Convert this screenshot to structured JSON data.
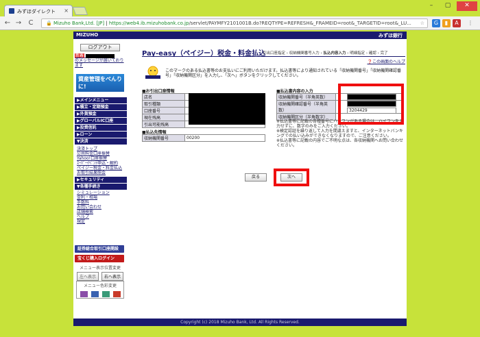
{
  "browser": {
    "tab_title": "みずほダイレクト",
    "tab_close": "×",
    "win_min": "–",
    "win_max": "▢",
    "win_close": "✕",
    "back": "←",
    "forward": "→",
    "reload": "C",
    "url_secure_label": "Mizuho Bank,Ltd. [JP]",
    "url_host": "https://web4.ib.mizuhobank.co.jp",
    "url_path": "/servlet/PAYMFY2101001B.do?REQTYPE=REFRESH&_FRAMEID=root&_TARGETID=root&_LU..."
  },
  "header": {
    "logo": "MIZUHO",
    "right_logo": "みずほ銀行"
  },
  "sidebar": {
    "logout": "ログアウト",
    "notice_new": "新着",
    "notice_text": "のメッセージが届いております",
    "banner_title": "資産管理をべんりに!",
    "banner_sub": "マイページはこちら",
    "menu_main": "▶メインメニュー",
    "menu_deposit": "▶積立・定期預金",
    "menu_forex": "▶外貨預金",
    "menu_global": "▶グローバルIC口座",
    "menu_invest": "▶投資信託",
    "menu_loan": "▶ローン",
    "menu_settle": "▼決済",
    "settle_items": [
      "決済トップ",
      "公共料金口座振替",
      "Yahoo!口座振替",
      "ｽｰﾊﾟｰｲﾍﾞﾝﾄ申込・解約",
      "ペイジー税金・料金払込",
      "お取引結果照会"
    ],
    "menu_security": "▶セキュリティ",
    "menu_procedures": "▼各種手続き",
    "procedure_items": [
      "シミュレーション",
      "金利・相場",
      "手数料",
      "お問い合わせ",
      "店舗検索",
      "ヘルプ",
      "規定"
    ],
    "btn_securities": "証券総合取引口座開設",
    "btn_lottery": "宝くじ購入ログイン",
    "menu_position": "メニュー表示位置変更",
    "left_label": "左へ表示",
    "right_label": "右へ表示",
    "color_change": "メニュー色彩変更",
    "swatches": [
      "#8a4ea8",
      "#3a62b0",
      "#3a9a78",
      "#c83a2a"
    ]
  },
  "main": {
    "title": "Pay-easy（ペイジー）税金・料金払込",
    "steps": {
      "s1": "引出口座指定",
      "s2": "収納機関番号入力",
      "s3": "払込内容入力",
      "s4": "明細指定",
      "s5": "確認",
      "s6": "完了",
      "sep": " › "
    },
    "help": "この画面のヘルプ",
    "icon_label": "Pay-easy",
    "intro": "このマークのある払込書等のお支払いにご利用いただけます。払込書等により通知されている「収納機関番号」「収納機関確認番号」「収納機関区分」を入力し、「次へ」ボタンをクリックしてください。",
    "account_head": "■お引出口座情報",
    "account_rows": [
      "店名",
      "取引種類",
      "口座番号",
      "現在残高",
      "引出可能残高"
    ],
    "payee_head": "■払込先情報",
    "payee_label": "収納機関番号",
    "payee_value": "00200",
    "input_head": "■払込書内容の入力",
    "input_rows": [
      {
        "label": "収納機関番号（半角英数）",
        "value": ""
      },
      {
        "label": "収納機関確認番号（半角英数）",
        "value": ""
      },
      {
        "label": "収納機関区分（半角数字）",
        "value": "3204429"
      }
    ],
    "note1": "※払込書等に記載の各種番号にハイフンがある場合は、ハイフンを入力せずに、数字のみをご入力ください。",
    "note2": "※検定認証を繰り返して入力を間違えますと、インターネットバンキングでの払い込みができなくなりますので、ご注意ください。",
    "note3": "※払込書等に記載の内容でご不明な点は、各収納機関へお問い合わせください。",
    "back_button": "戻る",
    "next_button": "次へ",
    "highlight_color": "#ef0f0f"
  },
  "footer": {
    "copyright": "Copyright (c) 2018 Mizuho Bank, Ltd. All Rights Reserved."
  }
}
